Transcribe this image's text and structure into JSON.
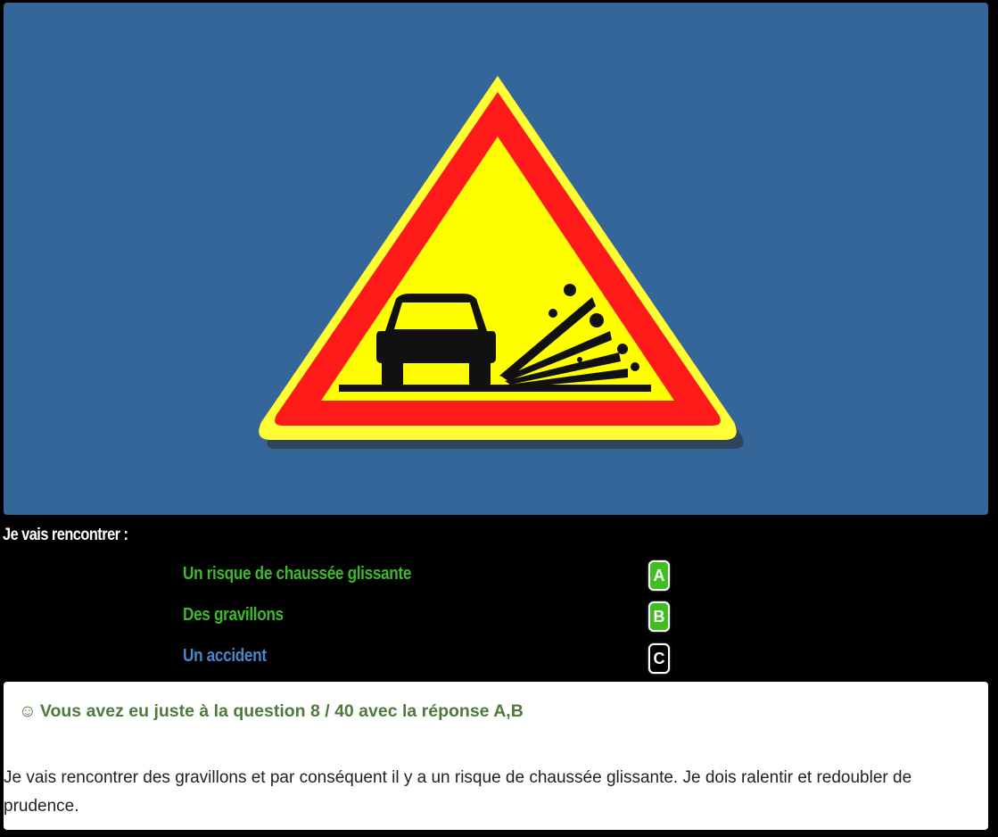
{
  "sign": {
    "description_icon": "warning-gravel-road-sign-icon",
    "colors": {
      "panel": "#35669a",
      "border_red": "#ff1a1a",
      "inner_yellow": "#ffff00",
      "outer_yellow": "#ffff33"
    }
  },
  "question": {
    "text": "Je vais rencontrer :"
  },
  "answers": [
    {
      "text": "Un risque de chaussée glissante",
      "letter": "A",
      "state": "correct"
    },
    {
      "text": "Des gravillons",
      "letter": "B",
      "state": "correct"
    },
    {
      "text": "Un accident",
      "letter": "C",
      "state": "neutral"
    }
  ],
  "result": {
    "icon": "☺",
    "title": "Vous avez eu juste à la question 8 / 40 avec la réponse A,B",
    "explanation": "Je vais rencontrer des gravillons et par conséquent il y a un risque de chaussée glissante. Je dois ralentir et redoubler de prudence."
  }
}
